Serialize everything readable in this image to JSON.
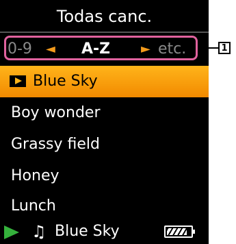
{
  "screen": {
    "title": "Todas canc.",
    "index_bar": {
      "left": "0-9",
      "left_arrow": "◄",
      "current": "A-Z",
      "right_arrow": "►",
      "right": "etc."
    },
    "items": [
      {
        "label": "Blue Sky",
        "selected": true
      },
      {
        "label": "Boy wonder"
      },
      {
        "label": "Grassy field"
      },
      {
        "label": "Honey"
      },
      {
        "label": "Lunch"
      }
    ],
    "status": {
      "play_icon": "play-icon",
      "note_icon": "music-note-icon",
      "now_playing": "Blue Sky",
      "battery_level": 0.85
    }
  },
  "callout": {
    "number": "1"
  },
  "colors": {
    "accent_highlight": "#f39b1c",
    "index_border": "#e0629e",
    "play_green": "#35b13c"
  }
}
